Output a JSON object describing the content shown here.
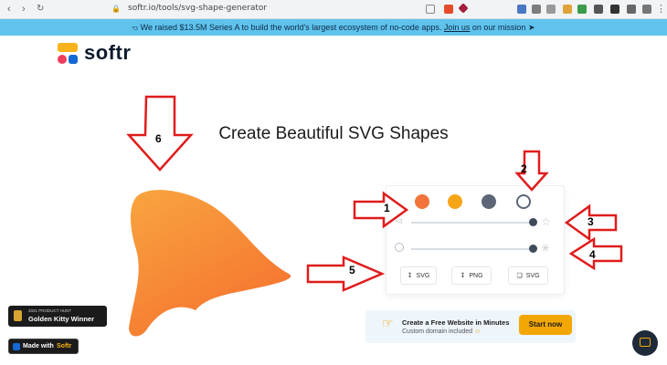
{
  "browser": {
    "url": "softr.io/tools/svg-shape-generator"
  },
  "banner": {
    "before_link": "We raised $13.5M Series A to build the world's largest ecosystem of no-code apps.",
    "link": "Join us",
    "after_link": "on our mission"
  },
  "logo": {
    "text": "softr"
  },
  "page": {
    "title": "Create Beautiful SVG Shapes"
  },
  "controls": {
    "colors": [
      "#f2743a",
      "#f6a518",
      "#5d6677"
    ],
    "download_svg": "SVG",
    "download_png": "PNG",
    "copy_svg": "SVG"
  },
  "cta": {
    "title": "Create a Free Website in Minutes",
    "subtitle": "Custom domain included",
    "button": "Start now"
  },
  "badges": {
    "kitty_top": "2021 PRODUCT HUNT",
    "kitty_main": "Golden Kitty Winner",
    "made_with": "Made with",
    "made_with_brand": "Softr"
  },
  "annotations": [
    "1",
    "2",
    "3",
    "4",
    "5",
    "6"
  ]
}
